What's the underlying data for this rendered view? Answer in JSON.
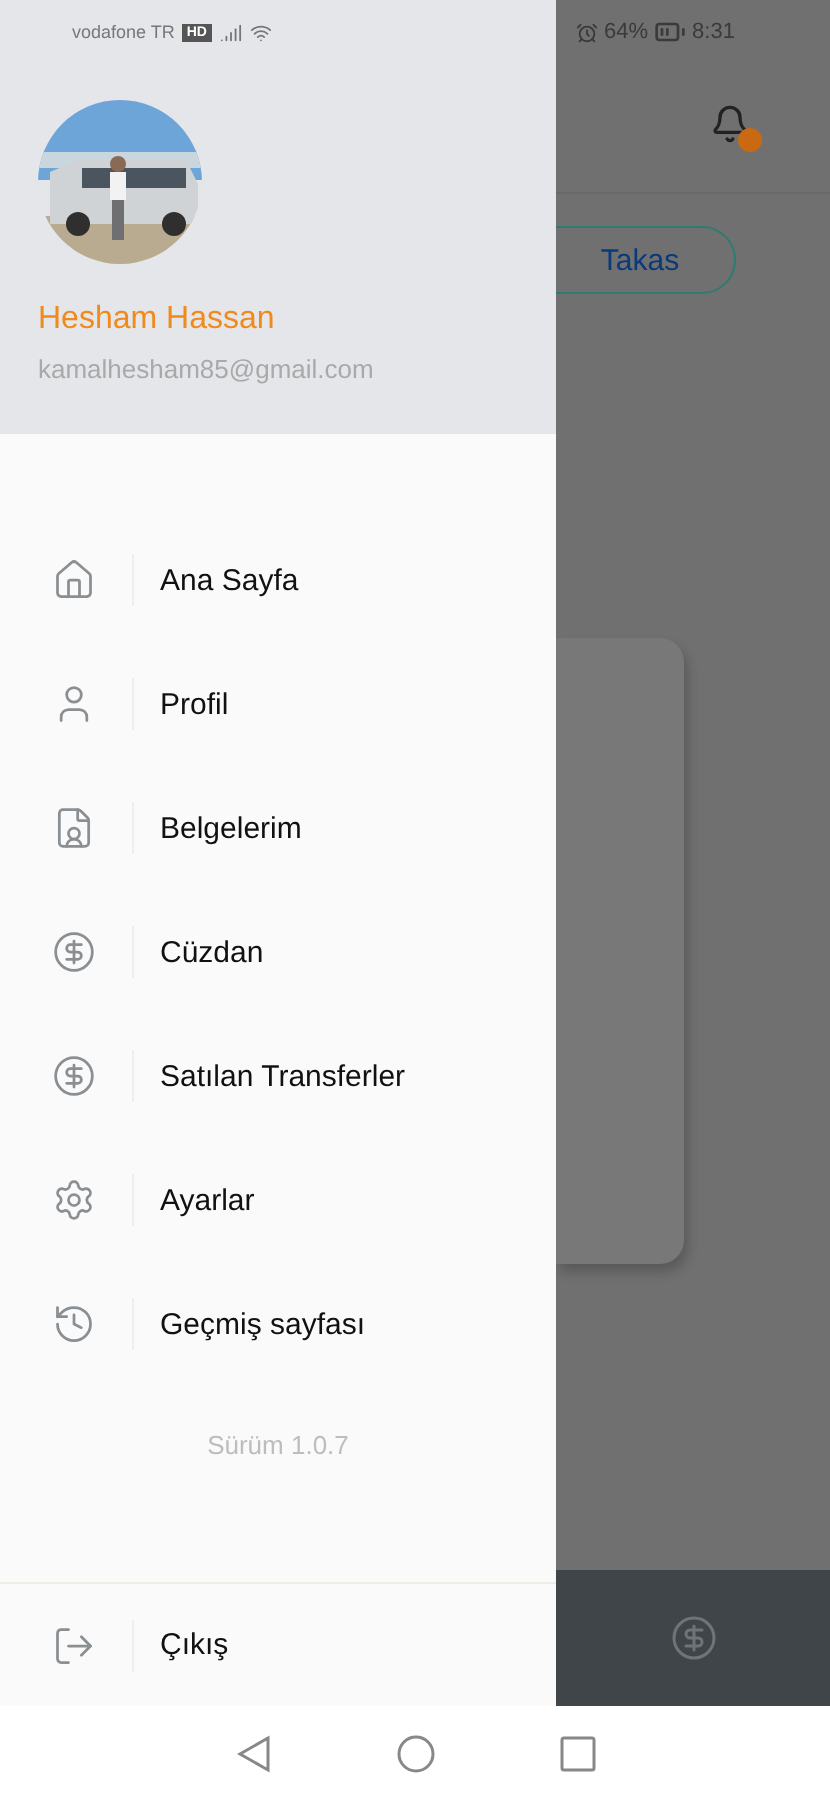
{
  "status_bar": {
    "carrier": "vodafone TR",
    "carrier_badge": "HD",
    "battery": "64%",
    "time": "8:31"
  },
  "profile": {
    "name": "Hesham Hassan",
    "email": "kamalhesham85@gmail.com"
  },
  "menu": [
    {
      "kind": "home",
      "label": "Ana Sayfa"
    },
    {
      "kind": "user",
      "label": "Profil"
    },
    {
      "kind": "document",
      "label": "Belgelerim"
    },
    {
      "kind": "dollar",
      "label": "Cüzdan"
    },
    {
      "kind": "dollar",
      "label": "Satılan Transferler"
    },
    {
      "kind": "settings",
      "label": "Ayarlar"
    },
    {
      "kind": "history",
      "label": "Geçmiş sayfası"
    }
  ],
  "version": "Sürüm 1.0.7",
  "logout": {
    "label": "Çıkış"
  },
  "background": {
    "exchange_button": "Takas"
  }
}
